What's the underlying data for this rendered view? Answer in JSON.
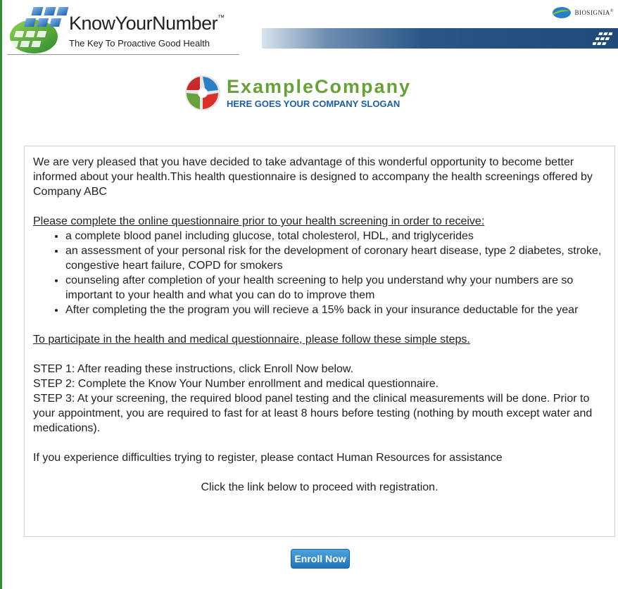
{
  "header": {
    "brand_title": "KnowYourNumber",
    "brand_tm": "™",
    "brand_tagline": "The Key To Proactive Good Health",
    "partner_name": "BIOSIGNIA",
    "partner_tm": "®"
  },
  "company": {
    "name": "ExampleCompany",
    "slogan": "HERE GOES YOUR COMPANY SLOGAN"
  },
  "content": {
    "intro": "We are very pleased that you have decided to take advantage of this wonderful opportunity to become better informed about your health.This health questionnaire is designed to accompany the health screenings offered by Company ABC",
    "section1_heading": "Please complete the online questionnaire prior to your health screening in order to receive:",
    "bullets": [
      "a complete blood panel including glucose, total cholesterol, HDL, and triglycerides",
      "an assessment of your personal risk for the development of coronary heart disease, type 2 diabetes, stroke, congestive heart failure, COPD for smokers",
      "counseling after completion of your health screening to help you understand why your numbers are so important to your health and what you can do to improve them",
      "After completing the the program you will recieve a 15% back in your insurance deductable for the year"
    ],
    "section2_heading": "To participate in the health and medical questionnaire, please follow these simple steps.",
    "steps": [
      "STEP 1: After reading these instructions, click Enroll Now below.",
      "STEP 2: Complete the Know Your Number enrollment and medical questionnaire.",
      "STEP 3: At your screening, the required blood panel testing and the clinical measurements will be done. Prior to your appointment, you are required to fast for at least 8 hours before testing (nothing by mouth except water and medications)."
    ],
    "contact": "If you experience difficulties trying to register, please contact Human Resources for assistance",
    "proceed": "Click the link below to proceed with registration."
  },
  "actions": {
    "enroll_label": "Enroll Now"
  },
  "colors": {
    "accent_blue": "#1e74b8",
    "company_green": "#6aa03c",
    "slogan_blue": "#1d5fa0",
    "left_bar": "#3a8a3a"
  }
}
